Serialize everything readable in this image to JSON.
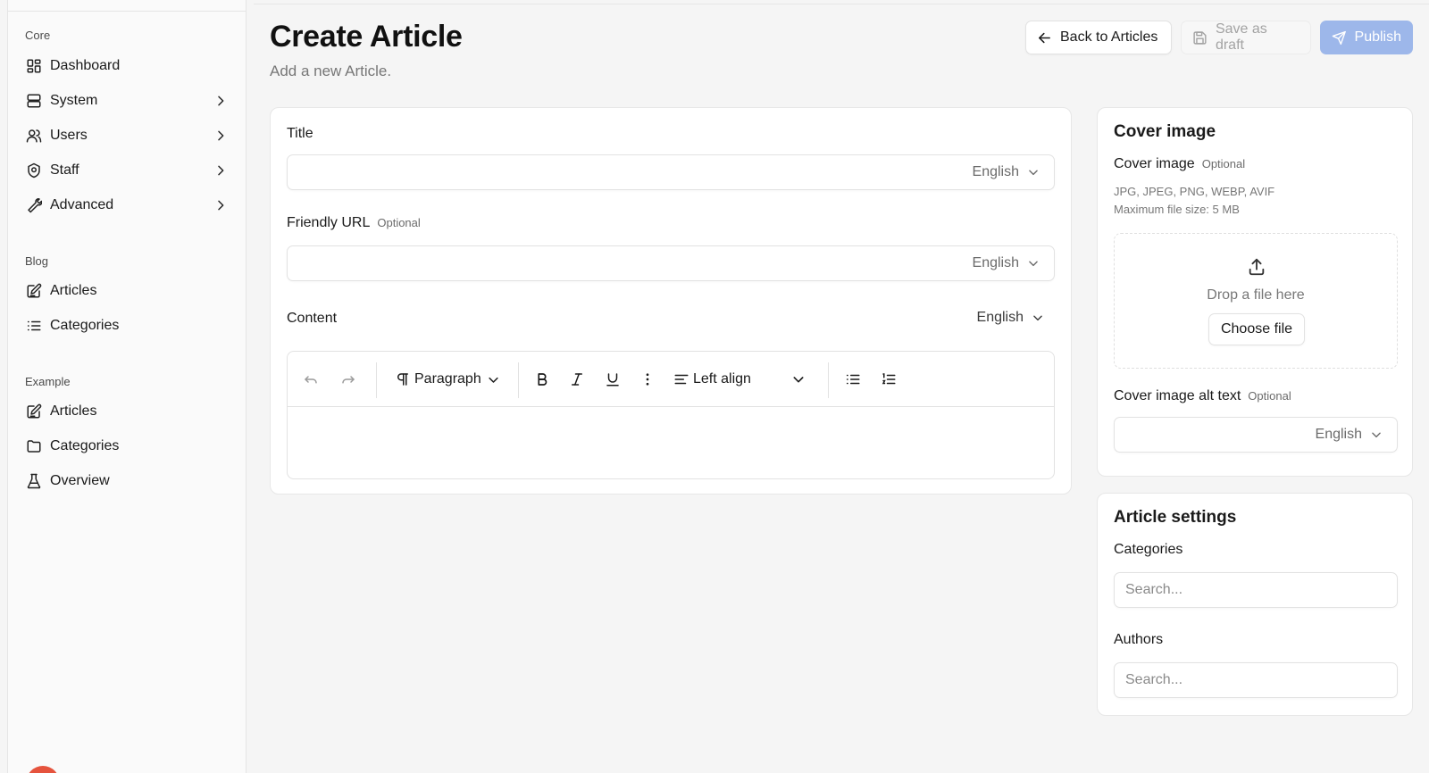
{
  "sidebar": {
    "sections": [
      {
        "label": "Core",
        "items": [
          {
            "label": "Dashboard",
            "icon": "dashboard-icon",
            "has_chevron": false
          },
          {
            "label": "System",
            "icon": "server-icon",
            "has_chevron": true
          },
          {
            "label": "Users",
            "icon": "users-icon",
            "has_chevron": true
          },
          {
            "label": "Staff",
            "icon": "shield-icon",
            "has_chevron": true
          },
          {
            "label": "Advanced",
            "icon": "wrench-icon",
            "has_chevron": true
          }
        ]
      },
      {
        "label": "Blog",
        "items": [
          {
            "label": "Articles",
            "icon": "edit-note-icon",
            "has_chevron": false
          },
          {
            "label": "Categories",
            "icon": "list-icon",
            "has_chevron": false
          }
        ]
      },
      {
        "label": "Example",
        "items": [
          {
            "label": "Articles",
            "icon": "edit-note-icon",
            "has_chevron": false
          },
          {
            "label": "Categories",
            "icon": "folder-icon",
            "has_chevron": false
          },
          {
            "label": "Overview",
            "icon": "flask-icon",
            "has_chevron": false
          }
        ]
      }
    ]
  },
  "header": {
    "title": "Create Article",
    "subtitle": "Add a new Article.",
    "back_label": "Back to Articles",
    "draft_label": "Save as draft",
    "publish_label": "Publish"
  },
  "form": {
    "title_label": "Title",
    "title_lang": "English",
    "url_label": "Friendly URL",
    "url_optional": "Optional",
    "url_lang": "English",
    "content_label": "Content",
    "content_lang": "English",
    "toolbar": {
      "paragraph_label": "Paragraph",
      "align_label": "Left align"
    }
  },
  "cover": {
    "card_title": "Cover image",
    "field_label": "Cover image",
    "optional": "Optional",
    "formats": "JPG, JPEG, PNG, WEBP, AVIF",
    "max_size": "Maximum file size: 5 MB",
    "drop_text": "Drop a file here",
    "choose_label": "Choose file",
    "alt_label": "Cover image alt text",
    "alt_optional": "Optional",
    "alt_lang": "English"
  },
  "settings": {
    "card_title": "Article settings",
    "categories_label": "Categories",
    "categories_placeholder": "Search...",
    "authors_label": "Authors",
    "authors_placeholder": "Search..."
  },
  "colors": {
    "publish": "#9db7ea",
    "avatar": "#e5533d"
  }
}
